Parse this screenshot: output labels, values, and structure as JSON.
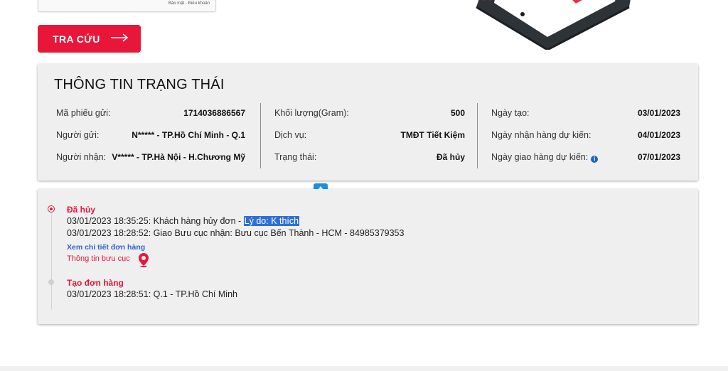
{
  "captcha": {
    "links": "Bảo mật - Điều khoản"
  },
  "search_button": {
    "label": "TRA CỨU"
  },
  "status": {
    "title": "THÔNG TIN TRẠNG THÁI",
    "col1": [
      {
        "label": "Mã phiếu gửi:",
        "value": "1714036886567"
      },
      {
        "label": "Người gửi:",
        "value": "N***** - TP.Hồ Chí Minh - Q.1"
      },
      {
        "label": "Người nhận:",
        "value": "V***** - TP.Hà Nội - H.Chương Mỹ"
      }
    ],
    "col2": [
      {
        "label": "Khối lượng(Gram):",
        "value": "500"
      },
      {
        "label": "Dịch vụ:",
        "value": "TMĐT Tiết Kiệm"
      },
      {
        "label": "Trạng thái:",
        "value": "Đã hủy"
      }
    ],
    "col3": [
      {
        "label": "Ngày tạo:",
        "value": "03/01/2023"
      },
      {
        "label": "Ngày nhận hàng dự kiến:",
        "value": "04/01/2023"
      },
      {
        "label": "Ngày giao hàng dự kiến:",
        "value": "07/01/2023"
      }
    ],
    "info_icon": "info-icon"
  },
  "timeline": {
    "events": [
      {
        "title": "Đã hủy",
        "line1_prefix": "03/01/2023 18:35:25: Khách hàng hủy đơn - ",
        "line1_highlight": "Lý do: K thích",
        "line2": "03/01/2023 18:28:52: Giao Bưu cục nhận: Bưu cục Bến Thành - HCM - 84985379353",
        "detail_link": "Xem chi tiết đơn hàng",
        "office_link": "Thông tin bưu cục"
      },
      {
        "title": "Tạo đơn hàng",
        "line1": "03/01/2023 18:28:51: Q.1 - TP.Hồ Chí Minh"
      }
    ]
  },
  "colors": {
    "accent": "#e8173a",
    "link": "#2f63d6",
    "drop_button": "#1a8fe6"
  }
}
